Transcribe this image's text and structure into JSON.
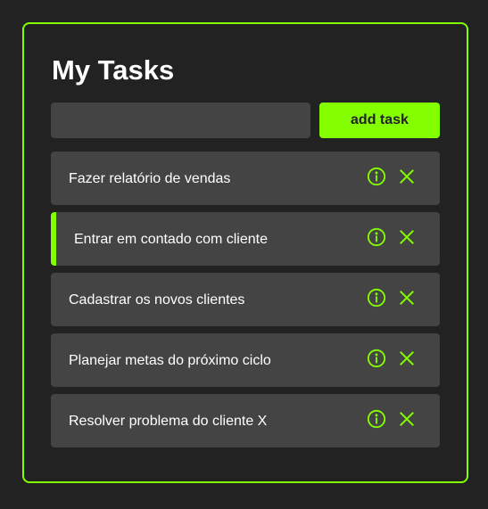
{
  "header": {
    "title": "My Tasks"
  },
  "form": {
    "input_value": "",
    "add_label": "add task"
  },
  "tasks": [
    {
      "label": "Fazer relatório de vendas",
      "active": false
    },
    {
      "label": "Entrar em contado com cliente",
      "active": true
    },
    {
      "label": "Cadastrar os novos clientes",
      "active": false
    },
    {
      "label": "Planejar metas do próximo ciclo",
      "active": false
    },
    {
      "label": "Resolver problema do cliente X",
      "active": false
    }
  ],
  "icons": {
    "info": "info-icon",
    "remove": "close-icon"
  },
  "colors": {
    "accent": "#84ff00",
    "background": "#222222",
    "card": "#444444",
    "text": "#ffffff"
  }
}
